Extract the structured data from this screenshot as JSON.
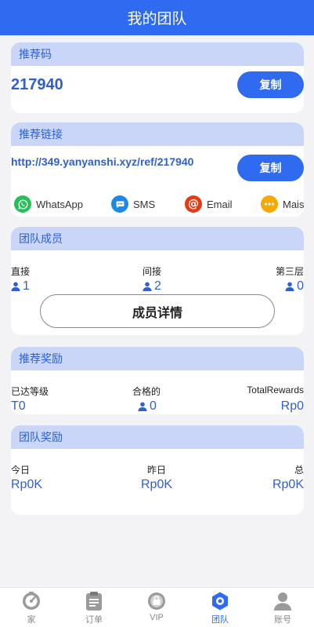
{
  "header": {
    "title": "我的团队"
  },
  "referral_code": {
    "title": "推荐码",
    "code": "217940",
    "copy_label": "复制"
  },
  "referral_link": {
    "title": "推荐链接",
    "url": "http://349.yanyanshi.xyz/ref/217940",
    "copy_label": "复制",
    "share": [
      {
        "label": "WhatsApp",
        "icon": "whatsapp-icon",
        "color": "#25c05a"
      },
      {
        "label": "SMS",
        "icon": "sms-icon",
        "color": "#1e88e5"
      },
      {
        "label": "Email",
        "icon": "email-icon",
        "color": "#e53a14"
      },
      {
        "label": "Mais",
        "icon": "more-icon",
        "color": "#f5a800"
      }
    ]
  },
  "team_members": {
    "title": "团队成员",
    "direct_label": "直接",
    "direct_value": "1",
    "indirect_label": "间接",
    "indirect_value": "2",
    "third_label": "第三层",
    "third_value": "0",
    "detail_label": "成员详情"
  },
  "referral_rewards": {
    "title": "推荐奖励",
    "level_label": "已达等级",
    "level_value": "T0",
    "qualified_label": "合格的",
    "qualified_value": "0",
    "total_label": "TotalRewards",
    "total_value": "Rp0"
  },
  "team_rewards": {
    "title": "团队奖励",
    "today_label": "今日",
    "today_value": "Rp0K",
    "yesterday_label": "昨日",
    "yesterday_value": "Rp0K",
    "total_label": "总",
    "total_value": "Rp0K"
  },
  "tabbar": {
    "items": [
      {
        "label": "家",
        "icon": "home-gauge-icon"
      },
      {
        "label": "订单",
        "icon": "clipboard-icon"
      },
      {
        "label": "VIP",
        "icon": "vip-badge-icon"
      },
      {
        "label": "团队",
        "icon": "team-hexagon-icon",
        "active": true
      },
      {
        "label": "账号",
        "icon": "account-icon"
      }
    ]
  },
  "colors": {
    "primary": "#2f6bf0",
    "card_head": "#c9d6f8",
    "accent_text": "#2f5fd0"
  }
}
